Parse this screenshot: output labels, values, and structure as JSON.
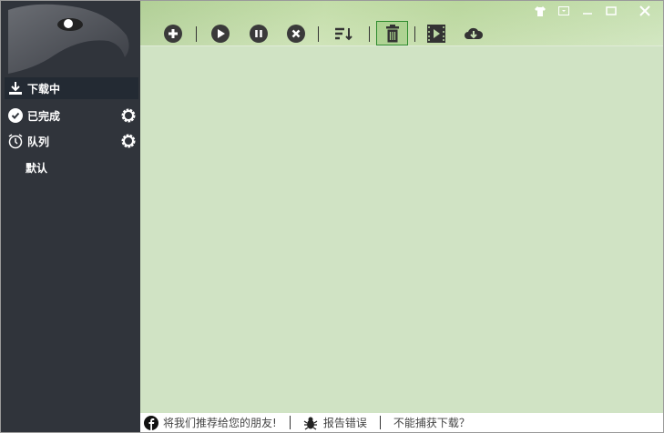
{
  "sidebar": {
    "items": [
      {
        "label": "下载中",
        "icon": "download-tray-icon",
        "active": true
      },
      {
        "label": "已完成",
        "icon": "check-circle-icon"
      },
      {
        "label": "队列",
        "icon": "alarm-clock-icon"
      },
      {
        "label": "默认"
      }
    ]
  },
  "toolbar": [
    "add",
    "start",
    "pause",
    "stop",
    "sort",
    "delete",
    "video",
    "cloud-download"
  ],
  "status": {
    "recommend": "将我们推荐给您的朋友!",
    "report": "报告错误",
    "cannot_capture": "不能捕获下载？"
  },
  "colors": {
    "sidebar": "#30343b",
    "main": "#d0e3c4",
    "accent": "#2e8b2e"
  }
}
